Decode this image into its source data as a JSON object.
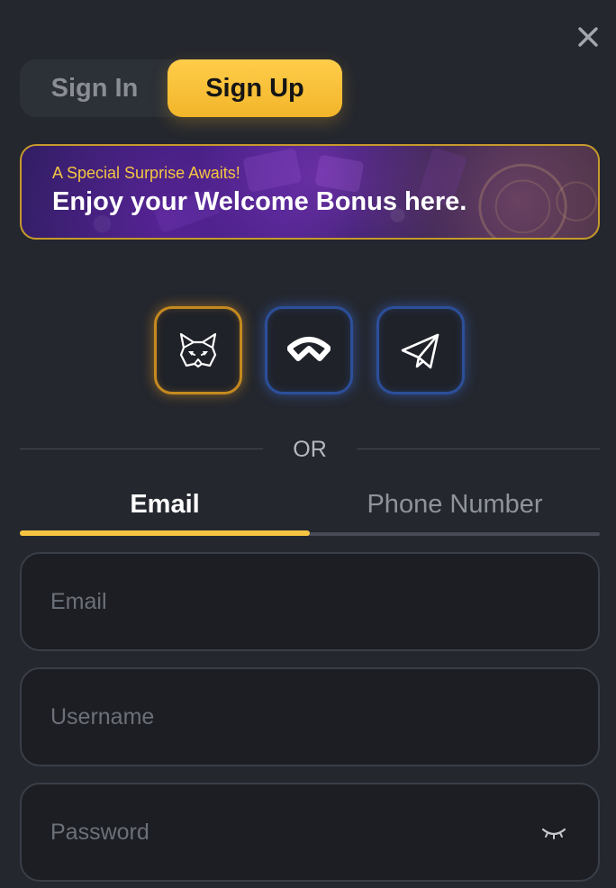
{
  "auth_toggle": {
    "sign_in_label": "Sign In",
    "sign_up_label": "Sign Up",
    "active": "sign_up"
  },
  "promo": {
    "subtitle": "A Special Surprise Awaits!",
    "title": "Enjoy your Welcome Bonus here."
  },
  "wallets": [
    {
      "icon": "metamask-fox-icon",
      "accent": "#c58a1f"
    },
    {
      "icon": "walletconnect-icon",
      "accent": "#2c4f9a"
    },
    {
      "icon": "telegram-icon",
      "accent": "#2c4f9a"
    }
  ],
  "divider": {
    "label": "OR"
  },
  "method_tabs": {
    "email_label": "Email",
    "phone_label": "Phone Number",
    "active": "email"
  },
  "form": {
    "email_placeholder": "Email",
    "username_placeholder": "Username",
    "password_placeholder": "Password"
  },
  "colors": {
    "background": "#24272e",
    "accent_gold": "#f5c542",
    "field_bg": "#1c1e24",
    "wallet_blue": "#2c4f9a"
  }
}
